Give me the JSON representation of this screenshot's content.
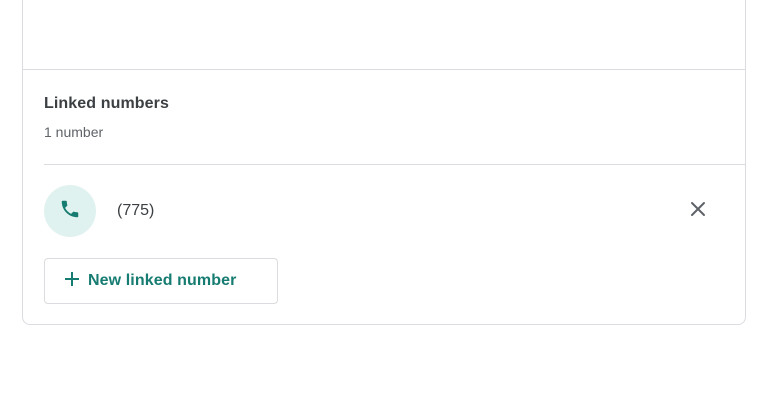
{
  "linked_numbers": {
    "title": "Linked numbers",
    "count_label": "1 number",
    "items": [
      {
        "number": "(775)",
        "icon": "phone-icon",
        "remove_icon": "close-icon"
      }
    ],
    "add_button_label": "New linked number",
    "add_icon": "plus-icon"
  },
  "colors": {
    "accent": "#167c71",
    "avatar_bg": "#e0f2ef",
    "border": "#dadce0"
  }
}
